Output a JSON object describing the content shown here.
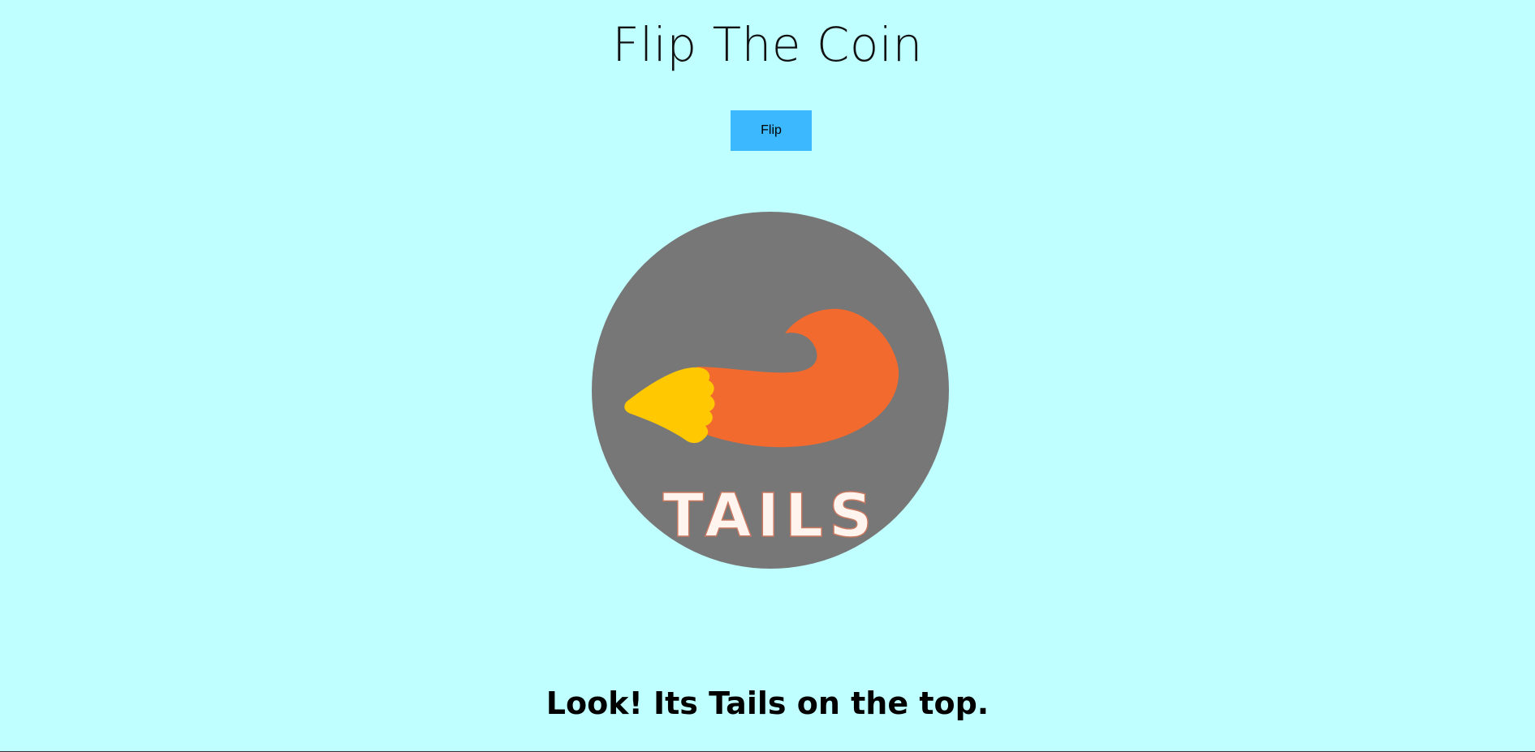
{
  "app": {
    "title": "Flip The Coin"
  },
  "controls": {
    "flip_label": "Flip"
  },
  "coin": {
    "face": "TAILS",
    "icon": "fox-tail-icon",
    "colors": {
      "coin": "#777777",
      "tail_body": "#f26a2e",
      "tail_tip": "#ffc800",
      "lettering": "#fff4ee",
      "lettering_outline": "#c87860"
    }
  },
  "result": {
    "message": "Look! Its Tails on the top."
  },
  "theme": {
    "background": "#c0ffff",
    "button": "#3cb8ff"
  }
}
